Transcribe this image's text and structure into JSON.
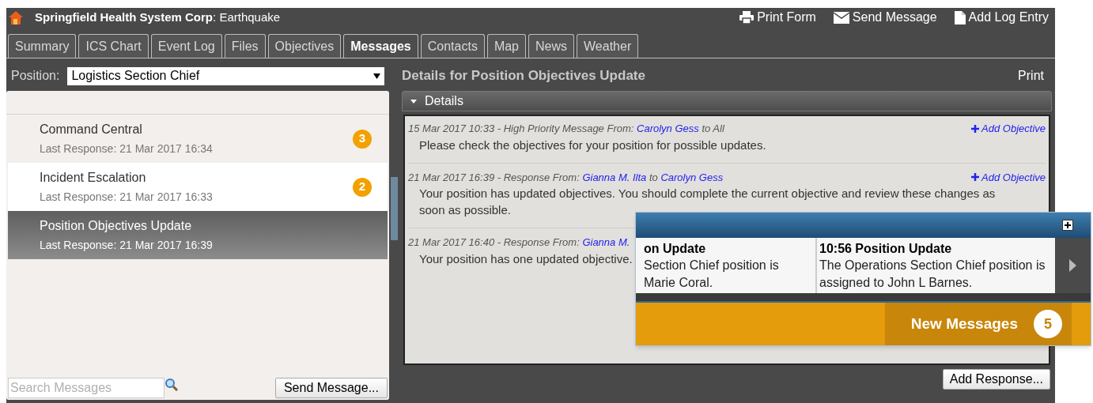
{
  "header": {
    "title": "**Springfield Health System Corp**: Earthquake",
    "actions": [
      {
        "kind": "print",
        "label": "Print Form"
      },
      {
        "kind": "mail",
        "label": "Send Message"
      },
      {
        "kind": "page",
        "label": "Add Log Entry"
      }
    ]
  },
  "tabs": [
    {
      "label": "Summary",
      "selected": false
    },
    {
      "label": "ICS Chart",
      "selected": false
    },
    {
      "label": "Event Log",
      "selected": false
    },
    {
      "label": "Files",
      "selected": false
    },
    {
      "label": "Objectives",
      "selected": false
    },
    {
      "label": "Messages",
      "selected": true
    },
    {
      "label": "Contacts",
      "selected": false
    },
    {
      "label": "Map",
      "selected": false
    },
    {
      "label": "News",
      "selected": false
    },
    {
      "label": "Weather",
      "selected": false
    }
  ],
  "position": {
    "label": "Position:",
    "value": "Logistics Section Chief"
  },
  "threads": [
    {
      "title": "Command Central",
      "subtitle": "Last Response: 21 Mar 2017 16:34",
      "count": "3",
      "selected": false,
      "hovered": false
    },
    {
      "title": "Incident Escalation",
      "subtitle": "Last Response: 21 Mar 2017 16:33",
      "count": "2",
      "selected": false,
      "hovered": true
    },
    {
      "title": "Position Objectives Update",
      "subtitle": "Last Response: 21 Mar 2017 16:39",
      "selected": true,
      "hovered": false
    }
  ],
  "search": {
    "placeholder": "Search Messages"
  },
  "send_button": "Send Message...",
  "details": {
    "title": "Details for Position Objectives Update",
    "print": "Print",
    "section": "Details",
    "expanded": true,
    "messages": [
      {
        "meta": "15 Mar 2017 10:33 - High Priority Message From: ",
        "from": "Carolyn Gess",
        "to_label": " to All",
        "action": "Add Objective",
        "body": "Please check the objectives for your position for possible updates."
      },
      {
        "meta": "21 Mar 2017 16:39 - Response From: ",
        "from": "Gianna M. Ilta",
        "to_label": " to ",
        "to": "Carolyn Gess",
        "action": "Add Objective",
        "body": "Your position has updated objectives. You should complete the current objective and review these changes as soon as possible."
      },
      {
        "meta": "21 Mar 2017 16:40 - Response From: ",
        "from": "Gianna M.",
        "body": "Your position has one updated objective."
      }
    ],
    "add_response": "Add Response..."
  },
  "popup": {
    "cards": [
      {
        "title": "on Update",
        "body": "Section Chief position is Marie Coral."
      },
      {
        "title": "10:56 Position Update",
        "body": "The Operations Section Chief position is assigned to John L Barnes."
      }
    ],
    "banner": "New Messages",
    "count": "5"
  }
}
